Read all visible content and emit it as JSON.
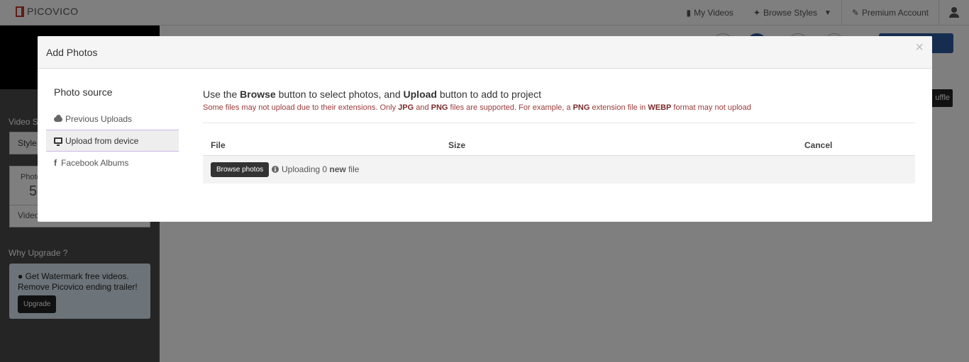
{
  "app": {
    "brand": "PICOVICO",
    "nav": {
      "my_videos": "My Videos",
      "browse_styles": "Browse Styles",
      "premium": "Premium Account"
    }
  },
  "sidebar": {
    "video_label": "Video Su",
    "style_select": "Style",
    "card_photos_label": "Photo",
    "card_photos_count": "5",
    "card_video_label": "Video",
    "why_upgrade": "Why Upgrade ?",
    "upgrade_text_1": "Get Watermark free videos.",
    "upgrade_text_2": "Remove Picovico ending trailer!",
    "upgrade_button": "Upgrade"
  },
  "main": {
    "shuffle_label": "uffle"
  },
  "modal": {
    "title": "Add Photos",
    "close": "×",
    "source_title": "Photo source",
    "sources": [
      {
        "label": "Previous Uploads",
        "icon": "cloud-icon"
      },
      {
        "label": "Upload from device",
        "icon": "monitor-icon",
        "active": true
      },
      {
        "label": "Facebook Albums",
        "icon": "facebook-icon"
      }
    ],
    "instruction": {
      "p1": "Use the ",
      "browse": "Browse",
      "p2": " button to select photos, and ",
      "upload": "Upload",
      "p3": " button to add to project"
    },
    "warning": {
      "w1": "Some files may not upload due to their extensions. Only ",
      "jpg": "JPG",
      "w2": " and ",
      "png": "PNG",
      "w3": " files are supported. For example, a ",
      "png2": "PNG",
      "w4": " extension file in ",
      "webp": "WEBP",
      "w5": " format may not upload"
    },
    "table": {
      "col_file": "File",
      "col_size": "Size",
      "col_cancel": "Cancel"
    },
    "browse_button": "Browse photos",
    "status": {
      "s1": "Uploading 0 ",
      "new": "new",
      "s2": " file"
    }
  }
}
